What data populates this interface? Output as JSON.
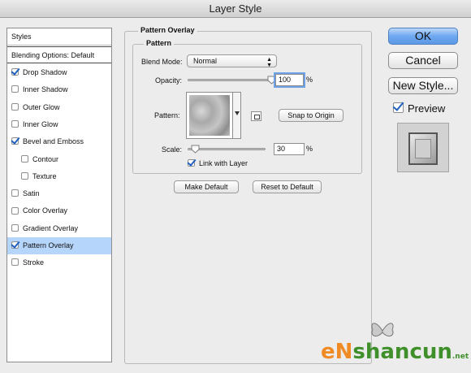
{
  "window": {
    "title": "Layer Style"
  },
  "sidebar": {
    "header": "Styles",
    "blending": "Blending Options: Default",
    "items": [
      {
        "label": "Drop Shadow",
        "checked": true,
        "indent": false
      },
      {
        "label": "Inner Shadow",
        "checked": false,
        "indent": false
      },
      {
        "label": "Outer Glow",
        "checked": false,
        "indent": false
      },
      {
        "label": "Inner Glow",
        "checked": false,
        "indent": false
      },
      {
        "label": "Bevel and Emboss",
        "checked": true,
        "indent": false
      },
      {
        "label": "Contour",
        "checked": false,
        "indent": true
      },
      {
        "label": "Texture",
        "checked": false,
        "indent": true
      },
      {
        "label": "Satin",
        "checked": false,
        "indent": false
      },
      {
        "label": "Color Overlay",
        "checked": false,
        "indent": false
      },
      {
        "label": "Gradient Overlay",
        "checked": false,
        "indent": false
      },
      {
        "label": "Pattern Overlay",
        "checked": true,
        "indent": false,
        "selected": true
      },
      {
        "label": "Stroke",
        "checked": false,
        "indent": false
      }
    ]
  },
  "panel": {
    "title": "Pattern Overlay",
    "group_title": "Pattern",
    "blend_mode_label": "Blend Mode:",
    "blend_mode_value": "Normal",
    "opacity_label": "Opacity:",
    "opacity_value": "100",
    "opacity_unit": "%",
    "opacity_fraction": 1.0,
    "pattern_label": "Pattern:",
    "snap_button": "Snap to Origin",
    "scale_label": "Scale:",
    "scale_value": "30",
    "scale_unit": "%",
    "scale_fraction": 0.1,
    "link_label": "Link with Layer",
    "link_checked": true,
    "make_default": "Make Default",
    "reset_default": "Reset to Default"
  },
  "actions": {
    "ok": "OK",
    "cancel": "Cancel",
    "new_style": "New Style...",
    "preview": "Preview",
    "preview_checked": true
  },
  "watermark": {
    "e": "e",
    "n": "N",
    "shancun": "shancun",
    "net": ".net"
  },
  "colors": {
    "selection": "#b5d5fb",
    "accent": "#5c98e6",
    "check": "#1f5fbf"
  }
}
